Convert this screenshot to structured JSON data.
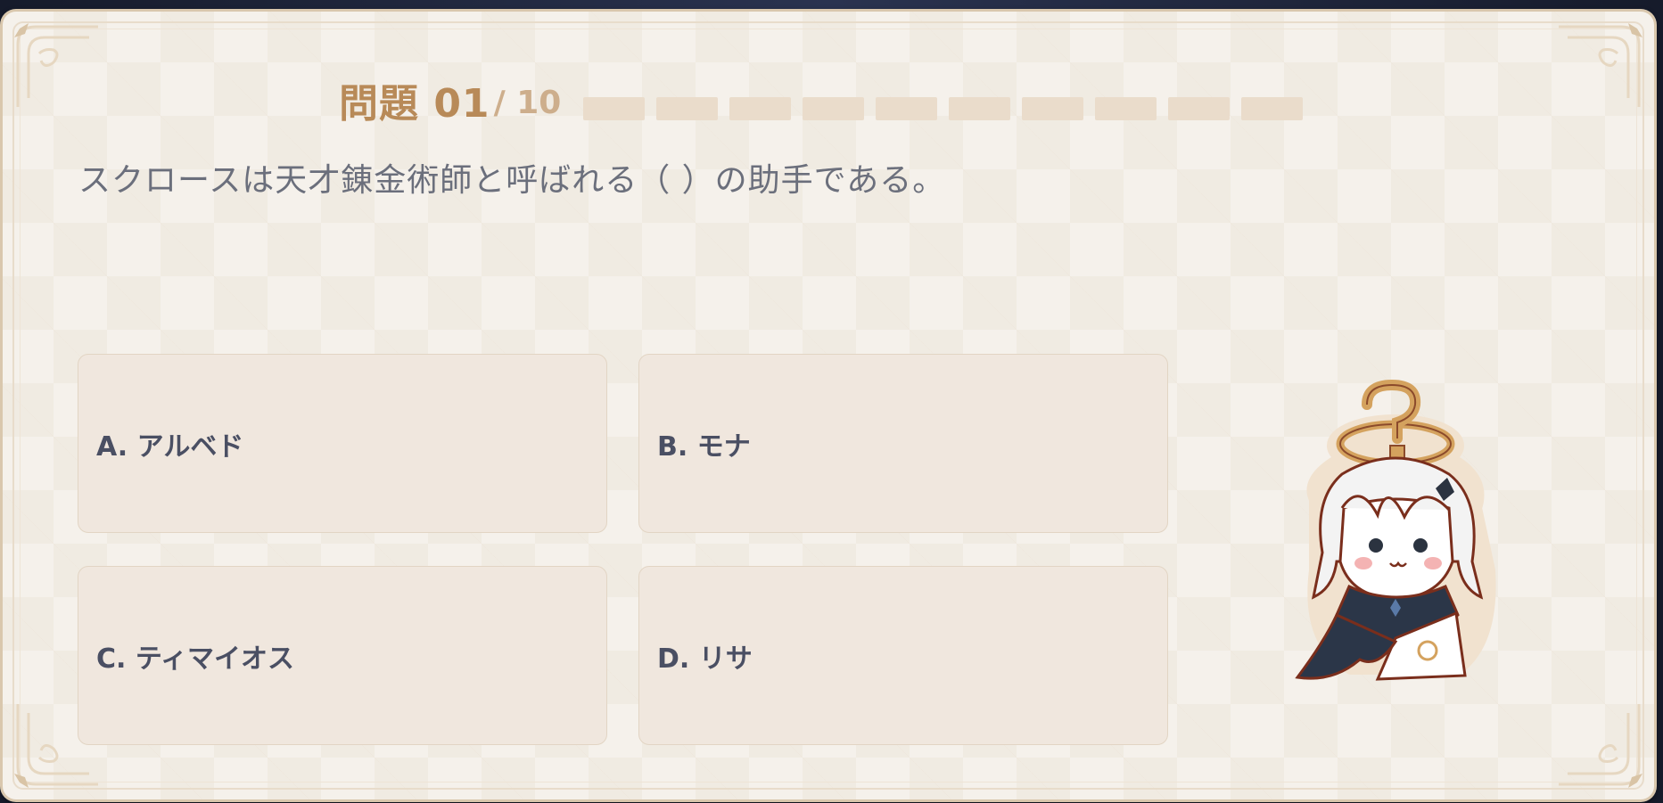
{
  "quiz": {
    "question_label": "問題 01",
    "question_total": "/ 10",
    "progress": {
      "current": 1,
      "total": 10
    },
    "question_text": "スクロースは天才錬金術師と呼ばれる（ ）の助手である。",
    "options": [
      {
        "label": "A. アルベド"
      },
      {
        "label": "B. モナ"
      },
      {
        "label": "C. ティマイオス"
      },
      {
        "label": "D. リサ"
      }
    ]
  },
  "theme": {
    "accent": "#b88a58",
    "card_bg": "#f5f1eb",
    "option_bg": "#f0e7de",
    "option_text": "#4a4f63",
    "progress_empty": "#eadccb"
  },
  "mascot": {
    "icon": "confused-chibi-mascot-icon"
  }
}
